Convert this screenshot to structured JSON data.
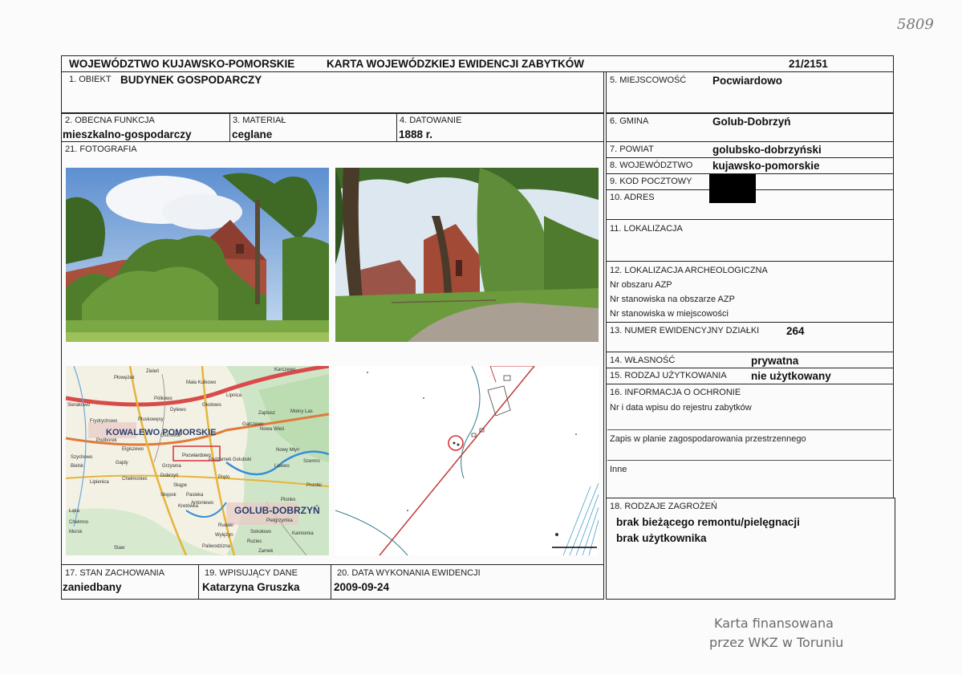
{
  "handwritten_number": "5809",
  "header": {
    "region": "WOJEWÓDZTWO KUJAWSKO-POMORSKIE",
    "card_title": "KARTA WOJEWÓDZKIEJ EWIDENCJI ZABYTKÓW",
    "card_number": "21/2151"
  },
  "fields": {
    "obiekt": {
      "label": "1. OBIEKT",
      "value": "BUDYNEK GOSPODARCZY"
    },
    "funkcja": {
      "label": "2. OBECNA FUNKCJA",
      "value": "mieszkalno-gospodarczy"
    },
    "material": {
      "label": "3. MATERIAŁ",
      "value": "ceglane"
    },
    "datowanie": {
      "label": "4. DATOWANIE",
      "value": "1888 r."
    },
    "miejscowosc": {
      "label": "5. MIEJSCOWOŚĆ",
      "value": "Pocwiardowo"
    },
    "gmina": {
      "label": "6. GMINA",
      "value": "Golub-Dobrzyń"
    },
    "powiat": {
      "label": "7. POWIAT",
      "value": "golubsko-dobrzyński"
    },
    "wojewodztwo": {
      "label": "8. WOJEWÓDZTWO",
      "value": "kujawsko-pomorskie"
    },
    "kod": {
      "label": "9. KOD POCZTOWY"
    },
    "adres": {
      "label": "10. ADRES"
    },
    "lokalizacja": {
      "label": "11. LOKALIZACJA"
    },
    "archeo": {
      "label": "12. LOKALIZACJA ARCHEOLOGICZNA",
      "lines": [
        "Nr obszaru AZP",
        "Nr stanowiska na obszarze AZP",
        "Nr stanowiska w miejscowości"
      ]
    },
    "dzialka": {
      "label": "13. NUMER EWIDENCYJNY DZIAŁKI",
      "value": "264"
    },
    "wlasnosc": {
      "label": "14. WŁASNOŚĆ",
      "value": "prywatna"
    },
    "uzytkowanie": {
      "label": "15. RODZAJ UŻYTKOWANIA",
      "value": "nie użytkowany"
    },
    "ochrona": {
      "label": "16. INFORMACJA O OCHRONIE",
      "line1": "Nr i data wpisu do rejestru zabytków",
      "line2": "Zapis w planie zagospodarowania przestrzennego",
      "line3": "Inne"
    },
    "stan": {
      "label": "17. STAN ZACHOWANIA",
      "value": "zaniedbany"
    },
    "zagrozenia": {
      "label": "18. RODZAJE ZAGROŻEŃ",
      "value1": "brak bieżącego remontu/pielęgnacji",
      "value2": "brak użytkownika"
    },
    "wpisujacy": {
      "label": "19. WPISUJĄCY DANE",
      "value": "Katarzyna Gruszka"
    },
    "data": {
      "label": "20. DATA WYKONANIA EWIDENCJI",
      "value": "2009-09-24"
    },
    "fotografia": {
      "label": "21. FOTOGRAFIA"
    }
  },
  "map": {
    "town_main": "KOWALEWO POMORSKIE",
    "town_target": "Pocwiardowo",
    "town_city": "GOLUB-DOBRZYŃ",
    "places": [
      "Zieleń",
      "Płowężek",
      "Karczewo",
      "Mała Kulkowo",
      "Pólkowo",
      "Głodowo",
      "Lipnica",
      "Frydrychowo",
      "Dylewo",
      "Sierakowo",
      "Zaplusz",
      "Mokry Las",
      "Nowy Młyn",
      "Podborek",
      "Elgiszewo",
      "Lisewo",
      "Szychowo",
      "Gajdy",
      "Gałczewo",
      "Lipienica",
      "Bielsk",
      "Dobrzyń",
      "Chełmoniec",
      "Skępsk",
      "Sokołowo",
      "Antoniewo",
      "Pluskowęsy",
      "Wylężyn",
      "Nowa Wieś",
      "Grzywna",
      "Podzamek Golubski",
      "Kamionka",
      "Ruziec",
      "Łąka",
      "Paliwodzizna",
      "Ostrowite",
      "Prontki",
      "Chełmno",
      "Plonko",
      "Kretówka",
      "Pręto",
      "Pielgrzymka",
      "Skąpe",
      "Szemro",
      "Morsk",
      "Pasieka",
      "Rudaki",
      "Staw",
      "Zamek"
    ]
  },
  "stamp": {
    "line1": "Karta finansowana",
    "line2": "przez WKZ w Toruniu"
  },
  "colors": {
    "redact": "#000000",
    "road_red": "#d23a3a",
    "line": "#222222"
  }
}
